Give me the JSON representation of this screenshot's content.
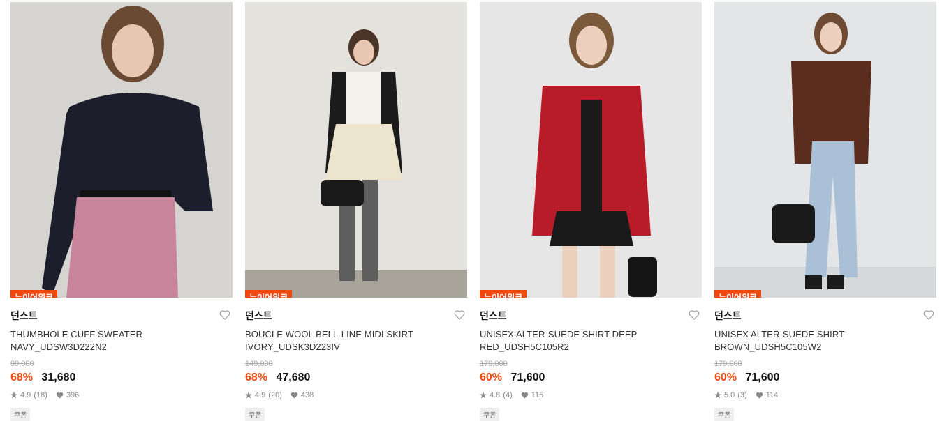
{
  "products": [
    {
      "badge": "뉴이어위크",
      "brand": "던스트",
      "name_line1": "THUMBHOLE CUFF SWEATER",
      "name_line2": "NAVY_UDSW3D222N2",
      "original_price": "99,000",
      "discount": "68%",
      "price": "31,680",
      "rating": "4.9",
      "reviews": "(18)",
      "likes": "396",
      "coupon": "쿠폰",
      "image_colors": {
        "bg": "#d9d8d4",
        "top": "#1c1f2b",
        "bottom": "#c7849a",
        "hair": "#6b4a33"
      }
    },
    {
      "badge": "뉴이어위크",
      "brand": "던스트",
      "name_line1": "BOUCLE WOOL BELL-LINE MIDI SKIRT",
      "name_line2": "IVORY_UDSK3D223IV",
      "original_price": "149,000",
      "discount": "68%",
      "price": "47,680",
      "rating": "4.9",
      "reviews": "(20)",
      "likes": "438",
      "coupon": "쿠폰",
      "image_colors": {
        "bg": "#e3e2dd",
        "top": "#f4f2ec",
        "bottom": "#ece4cc",
        "hair": "#4a3528"
      }
    },
    {
      "badge": "뉴이어위크",
      "brand": "던스트",
      "name_line1": "UNISEX ALTER-SUEDE SHIRT DEEP",
      "name_line2": "RED_UDSH5C105R2",
      "original_price": "179,000",
      "discount": "60%",
      "price": "71,600",
      "rating": "4.8",
      "reviews": "(4)",
      "likes": "115",
      "coupon": "쿠폰",
      "image_colors": {
        "bg": "#e6e6e6",
        "top": "#b71c28",
        "bottom": "#1a1a1a",
        "hair": "#7b5a3c"
      }
    },
    {
      "badge": "뉴이어위크",
      "brand": "던스트",
      "name_line1": "UNISEX ALTER-SUEDE SHIRT",
      "name_line2": "BROWN_UDSH5C105W2",
      "original_price": "179,000",
      "discount": "60%",
      "price": "71,600",
      "rating": "5.0",
      "reviews": "(3)",
      "likes": "114",
      "coupon": "쿠폰",
      "image_colors": {
        "bg": "#e4e5e7",
        "top": "#5a2d1e",
        "bottom": "#a9c0d6",
        "hair": "#6e4b32"
      }
    }
  ]
}
